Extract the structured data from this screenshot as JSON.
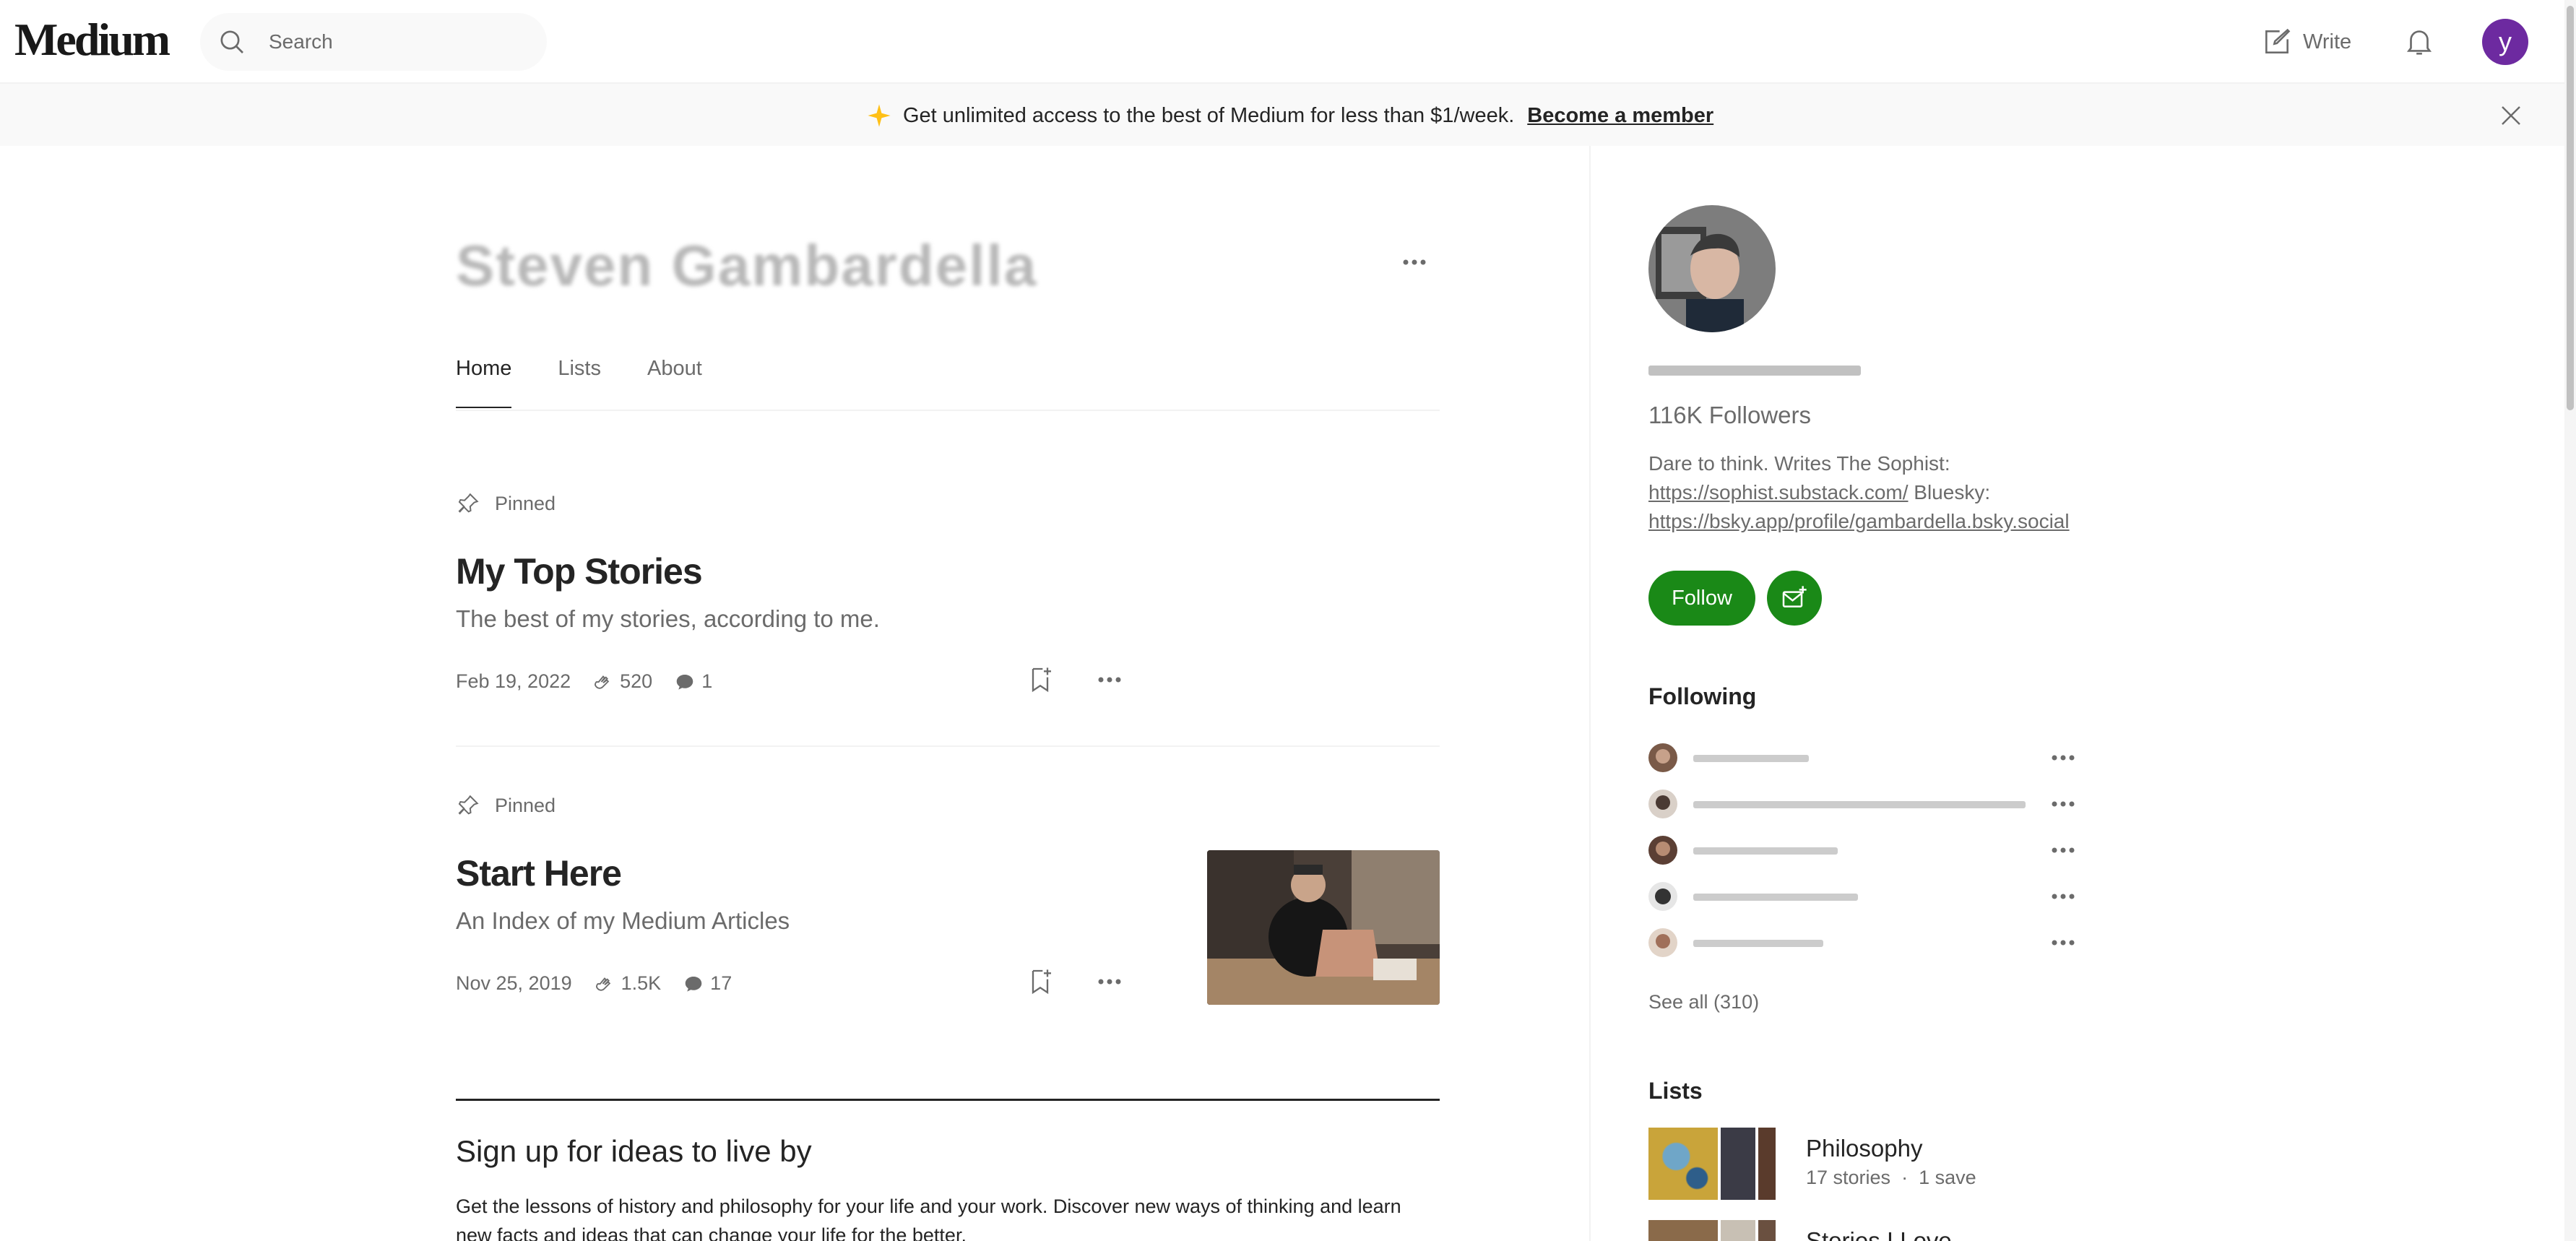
{
  "header": {
    "logo": "Medium",
    "search_placeholder": "Search",
    "write_label": "Write",
    "avatar_letter": "y"
  },
  "banner": {
    "text": "Get unlimited access to the best of Medium for less than $1/week.",
    "link": "Become a member"
  },
  "profile": {
    "name": "Steven Gambardella",
    "tabs": [
      "Home",
      "Lists",
      "About"
    ],
    "active_tab": "Home"
  },
  "posts": [
    {
      "pinned_label": "Pinned",
      "title": "My Top Stories",
      "subtitle": "The best of my stories, according to me.",
      "date": "Feb 19, 2022",
      "claps": "520",
      "responses": "1"
    },
    {
      "pinned_label": "Pinned",
      "title": "Start Here",
      "subtitle": "An Index of my Medium Articles",
      "date": "Nov 25, 2019",
      "claps": "1.5K",
      "responses": "17"
    }
  ],
  "cta": {
    "title": "Sign up for ideas to live by",
    "body": "Get the lessons of history and philosophy for your life and your work. Discover new ways of thinking and learn new facts and ideas that can change your life for the better."
  },
  "sidebar": {
    "followers": "116K Followers",
    "bio_text_1": "Dare to think. Writes The Sophist:",
    "bio_link_1": "https://sophist.substack.com/",
    "bio_text_2": "Bluesky:",
    "bio_link_2": "https://bsky.app/profile/gambardella.bsky.social",
    "follow_label": "Follow",
    "following_heading": "Following",
    "see_all": "See all (310)",
    "lists_heading": "Lists",
    "lists": [
      {
        "name": "Philosophy",
        "stories": "17 stories",
        "saves": "1 save"
      },
      {
        "name": "Stories I Love",
        "stories": "",
        "saves": ""
      }
    ]
  },
  "colors": {
    "brand_green": "#1a8917",
    "text_primary": "#242424",
    "text_secondary": "#6b6b6b",
    "avatar_purple": "#6d2aa0",
    "banner_star": "#ffc017"
  }
}
